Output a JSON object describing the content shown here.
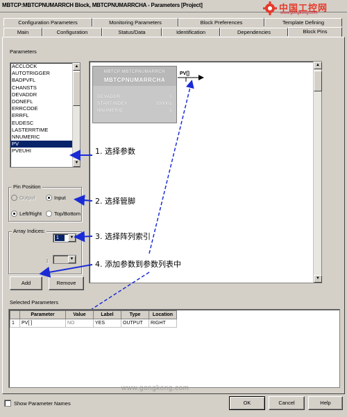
{
  "window": {
    "title": "MBTCP:MBTCPNUMARRCH Block, MBTCPNUMARRCHA - Parameters [Project]"
  },
  "logo": {
    "cn": "中国工控网",
    "en": "www.gongkong.com"
  },
  "tabs_row1": [
    "Configuration Parameters",
    "Monitoring Parameters",
    "Block Preferences",
    "Template Defining"
  ],
  "tabs_row2": [
    "Main",
    "Configuration",
    "Status/Data",
    "Identification",
    "Dependencies",
    "Block Pins"
  ],
  "parameters": {
    "label": "Parameters",
    "items": [
      "ACCLOCK",
      "AUTOTRIGGER",
      "BADPVFL",
      "CHANSTS",
      "DEVADDR",
      "DONEFL",
      "ERRCODE",
      "ERRFL",
      "EUDESC",
      "LASTERRTIME",
      "NNUMERIC",
      "PV",
      "PVEUHI"
    ],
    "selected": "PV"
  },
  "pin_position": {
    "label": "Pin Position",
    "output": "Output",
    "input": "Input",
    "leftright": "Left/Right",
    "topbottom": "Top/Bottom"
  },
  "array_indices": {
    "label": "Array Indices:",
    "value": "1"
  },
  "buttons": {
    "add": "Add",
    "remove": "Remove",
    "ok": "OK",
    "cancel": "Cancel",
    "help": "Help"
  },
  "block_preview": {
    "line1": "MBTCP:MBTCPNUMARRCH",
    "line2": "MBTCPNUMARRCHA",
    "fields": [
      {
        "name": "DEVADDR",
        "value": "1"
      },
      {
        "name": "STARTINDEX",
        "value": "200001"
      },
      {
        "name": "NNUMERIC",
        "value": "1"
      }
    ],
    "pin": "PV[]"
  },
  "annotations": {
    "a1": "1. 选择参数",
    "a2": "2. 选择管脚",
    "a3": "3. 选择阵列索引",
    "a4": "4. 添加参数到参数列表中"
  },
  "selected_parameters": {
    "label": "Selected Parameters",
    "columns": [
      "",
      "Parameter",
      "Value",
      "Label",
      "Type",
      "Location"
    ],
    "rows": [
      [
        "1",
        "PV[ ]",
        "NO",
        "YES",
        "OUTPUT",
        "RIGHT"
      ]
    ]
  },
  "show_param_names": "Show Parameter Names",
  "watermark": "www.gongkong.com",
  "colors": {
    "arrow_blue": "#1a2bd6",
    "selection": "#0a246a",
    "face": "#d4d0c8"
  }
}
